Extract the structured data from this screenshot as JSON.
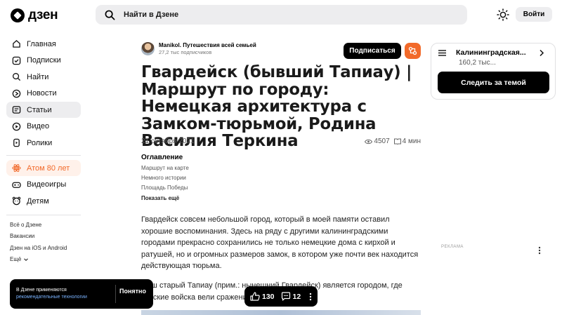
{
  "header": {
    "logo_text": "дзен",
    "search_placeholder": "Найти в Дзене",
    "login_label": "Войти"
  },
  "sidebar": {
    "items": [
      {
        "label": "Главная",
        "icon": "home-icon"
      },
      {
        "label": "Подписки",
        "icon": "subscriptions-icon"
      },
      {
        "label": "Найти",
        "icon": "search-icon"
      },
      {
        "label": "Новости",
        "icon": "news-icon"
      },
      {
        "label": "Статьи",
        "icon": "articles-icon"
      },
      {
        "label": "Видео",
        "icon": "video-icon"
      },
      {
        "label": "Ролики",
        "icon": "shorts-icon"
      }
    ],
    "atom": {
      "label": "Атом 80 лет",
      "icon": "atom-icon"
    },
    "extra": [
      {
        "label": "Видеоигры",
        "icon": "gamepad-icon"
      },
      {
        "label": "Детям",
        "icon": "kids-icon"
      }
    ],
    "footer": {
      "about": "Всё о Дзене",
      "jobs": "Вакансии",
      "apps": "Дзен на iOS и Android",
      "more": "Ещё"
    }
  },
  "article": {
    "author_name": "Manikol. Путешествия всей семьей",
    "author_subs": "27,2 тыс подписчиков",
    "subscribe_label": "Подписаться",
    "title": "Гвардейск (бывший Тапиау) | Маршрут по городу: Немецкая архитектура с Замком-тюрьмой, Родина Василия Теркина",
    "date": "21 октября 2021",
    "views": "4507",
    "read_time": "4 мин",
    "toc": {
      "heading": "Оглавление",
      "items": [
        "Маршрут на карте",
        "Немного истории",
        "Площадь Победы"
      ],
      "more": "Показать ещё"
    },
    "paragraph1": "Гвардейск совсем небольшой город, который в моей памяти оставил хорошие воспоминания. Здесь на ряду с другими калининградскими городами прекрасно сохранились не только немецкие дома с кирхой и ратушей, но и огромных размеров замок, в котором уже почти век находится действующая тюрьма.",
    "paragraph2_line1": "Наш старый Тапиау (прим.: нынешний Гвардейск) является городом, где",
    "paragraph2_line2": "русские войска вели сражения..."
  },
  "right": {
    "channel_name": "Калининградская...",
    "channel_subs": "160,2 тыс...",
    "follow_label": "Следить за темой",
    "ad_label": "РЕКЛАМА"
  },
  "cookie": {
    "line1": "В Дзене применяются",
    "link": "рекомендательные технологии",
    "ok_label": "Понятно"
  },
  "reactions": {
    "likes": "130",
    "comments": "12"
  },
  "colors": {
    "accent": "#f26a2a",
    "bg_button": "#ededef",
    "dark": "#000000"
  }
}
